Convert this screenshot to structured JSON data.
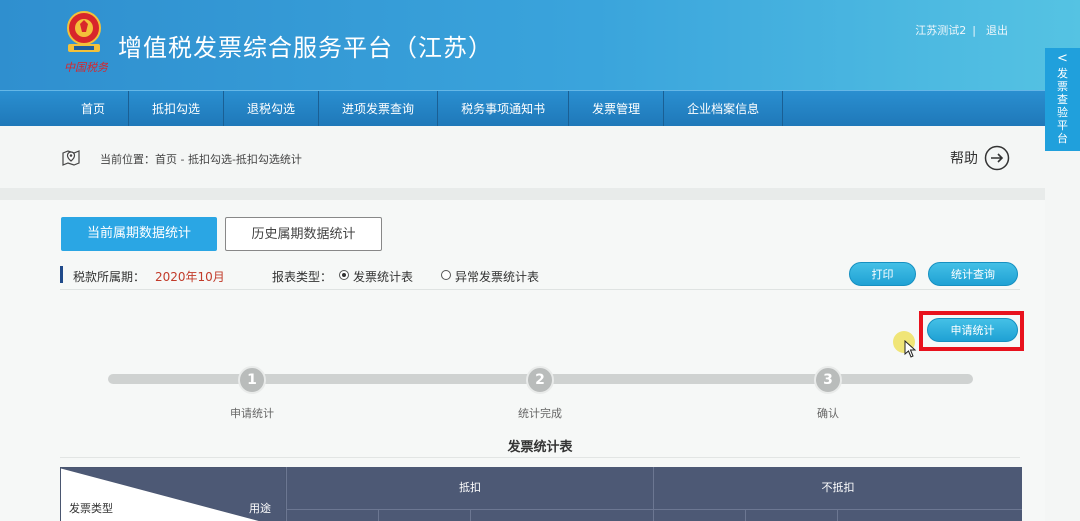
{
  "header": {
    "title": "增值税发票综合服务平台（江苏）",
    "user": "江苏测试2",
    "separator": "|",
    "logout": "退出",
    "emblem_text": "中国税务"
  },
  "nav": {
    "items": [
      "首页",
      "抵扣勾选",
      "退税勾选",
      "进项发票查询",
      "税务事项通知书",
      "发票管理",
      "企业档案信息"
    ]
  },
  "side_tab": {
    "arrow": "<",
    "label": "发票查验平台"
  },
  "breadcrumb": {
    "text": "当前位置：首页 - 抵扣勾选-抵扣勾选统计",
    "help": "帮助"
  },
  "tabs": {
    "current": "当前属期数据统计",
    "history": "历史属期数据统计"
  },
  "info": {
    "period_label": "税款所属期：",
    "period_value": "2020年10月",
    "type_label": "报表类型：",
    "radio_options": [
      {
        "label": "发票统计表",
        "selected": true
      },
      {
        "label": "异常发票统计表",
        "selected": false
      }
    ]
  },
  "buttons": {
    "print": "打印",
    "query": "统计查询",
    "apply": "申请统计"
  },
  "steps": [
    {
      "number": "1",
      "label": "申请统计"
    },
    {
      "number": "2",
      "label": "统计完成"
    },
    {
      "number": "3",
      "label": "确认"
    }
  ],
  "table": {
    "title": "发票统计表",
    "corner_left": "发票类型",
    "corner_right": "用途",
    "groups": [
      "抵扣",
      "不抵扣"
    ]
  },
  "colors": {
    "header_blue": "#2f8fcf",
    "nav_blue": "#2a8fd0",
    "accent": "#2aa6e4",
    "highlight_red": "#e8121d",
    "table_header": "#4d5975"
  }
}
